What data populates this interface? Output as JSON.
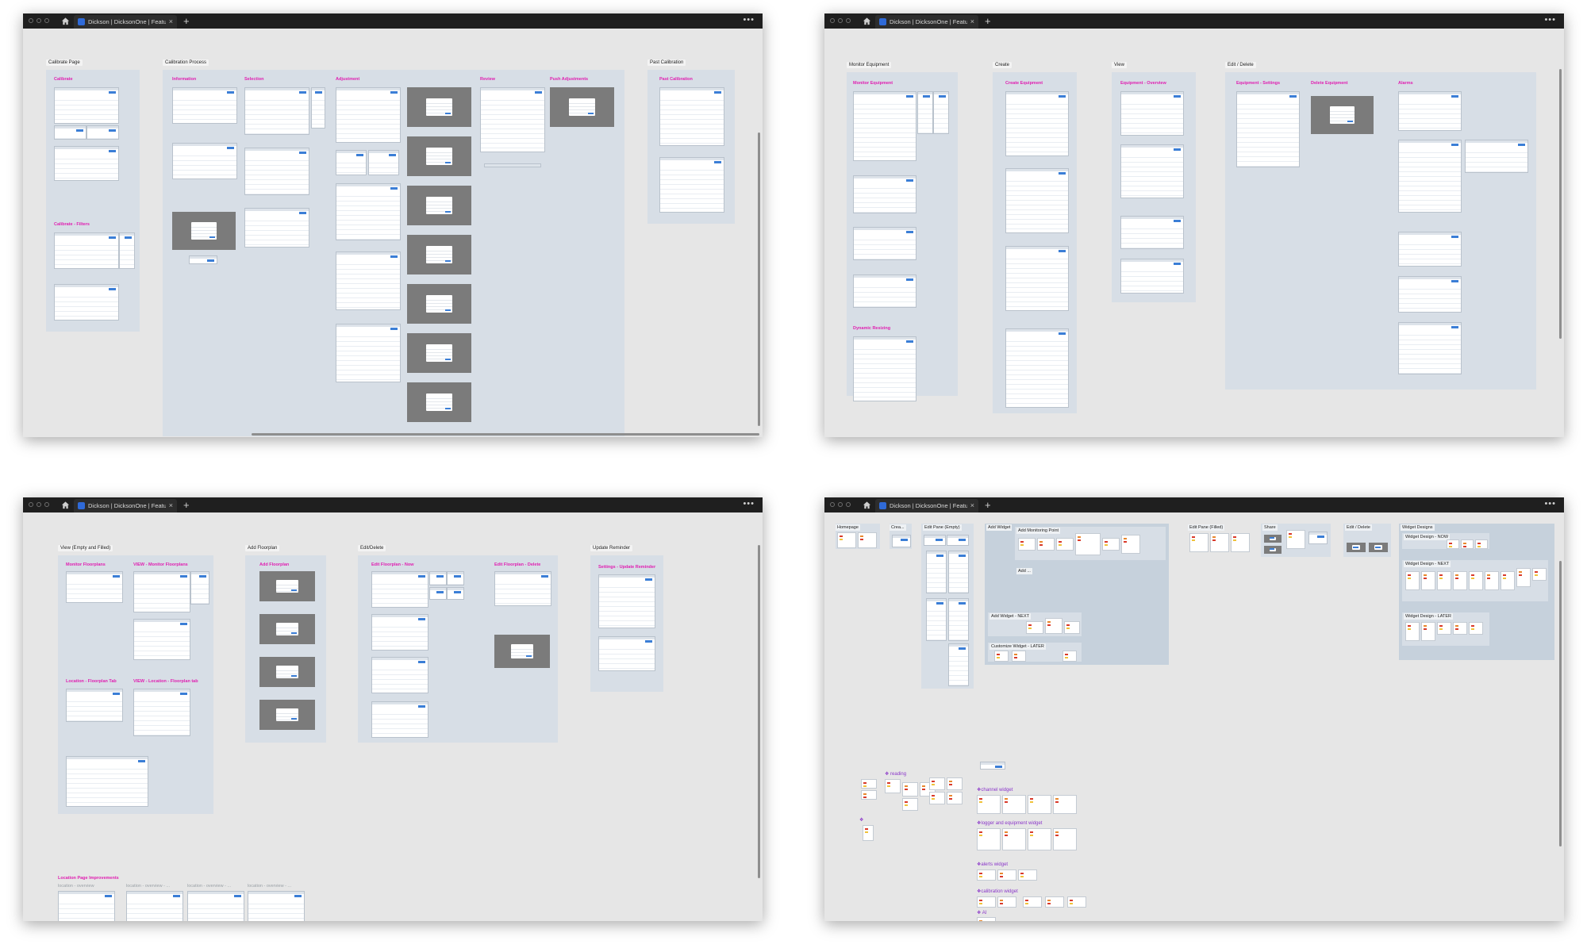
{
  "windows": [
    {
      "id": "calibration",
      "tab_title": "Dickson | DicksonOne | Feature Evoluti",
      "sections": [
        {
          "label": "Calibrate Page",
          "groups": [
            "Calibrate",
            "Calibrate - Filters"
          ]
        },
        {
          "label": "Calibration Process",
          "groups": [
            "Information",
            "Selection",
            "Adjustment",
            "Review",
            "Push Adjustments"
          ]
        },
        {
          "label": "Past Calibration",
          "groups": [
            "Past Calibration"
          ]
        }
      ]
    },
    {
      "id": "equipment",
      "tab_title": "Dickson | DicksonOne | Feature Evoluti",
      "sections": [
        {
          "label": "Monitor Equipment",
          "groups": [
            "Monitor Equipment",
            "Dynamic Resizing"
          ]
        },
        {
          "label": "Create",
          "groups": [
            "Create Equipment"
          ]
        },
        {
          "label": "View",
          "groups": [
            "Equipment - Overview"
          ]
        },
        {
          "label": "Edit / Delete",
          "groups": [
            "Equipment - Settings",
            "Delete Equipment",
            "Alarms"
          ]
        }
      ]
    },
    {
      "id": "floorplans",
      "tab_title": "Dickson | DicksonOne | Feature Evoluti",
      "sections": [
        {
          "label": "View (Empty and Filled)",
          "groups": [
            "Monitor Floorplans",
            "VIEW - Monitor Floorplans",
            "Location - Floorplan Tab",
            "VIEW - Location - Floorplan tab"
          ]
        },
        {
          "label": "Add Floorplan",
          "groups": [
            "Add Floorplan"
          ]
        },
        {
          "label": "Edit/Delete",
          "groups": [
            "Edit Floorplan - Now",
            "Edit Floorplan - Delete"
          ]
        },
        {
          "label": "Update Reminder",
          "groups": [
            "Settings - Update Reminder"
          ]
        }
      ],
      "improvements_title": "Location Page Improvements",
      "improvements_frames": [
        "location - overview",
        "location - overview - ...",
        "location - overview - ...",
        "location - overview - ..."
      ]
    },
    {
      "id": "widgets",
      "tab_title": "Dickson | DicksonOne | Feature Evoluti",
      "sections": [
        {
          "label": "Homepage"
        },
        {
          "label": "Crea..."
        },
        {
          "label": "Edit Pane (Empty)"
        },
        {
          "label": "Add Widget",
          "subs": [
            "Add Monitoring Point",
            "Add ...",
            "Add Widget - NEXT",
            "Customize Widget - LATER"
          ]
        },
        {
          "label": "Edit Pane (Filled)"
        },
        {
          "label": "Share"
        },
        {
          "label": "Edit / Delete"
        },
        {
          "label": "Widget Designs",
          "subs": [
            "Widget Design - NOW",
            "Widget Design - NEXT",
            "Widget Design - LATER"
          ]
        }
      ],
      "components": [
        "reading",
        "channel widget",
        "logger and equipment widget",
        "alerts widget",
        "calibration widget",
        "AI"
      ]
    }
  ],
  "colors": {
    "label_pink": "#e01fb1",
    "section_bg": "#d7dee6",
    "canvas_bg": "#e6e6e6",
    "titlebar": "#1f1f1f"
  },
  "icons": [
    "window-control-icon",
    "home-icon",
    "favicon-icon",
    "close-icon",
    "new-tab-icon",
    "more-icon",
    "component-diamond-icon"
  ]
}
